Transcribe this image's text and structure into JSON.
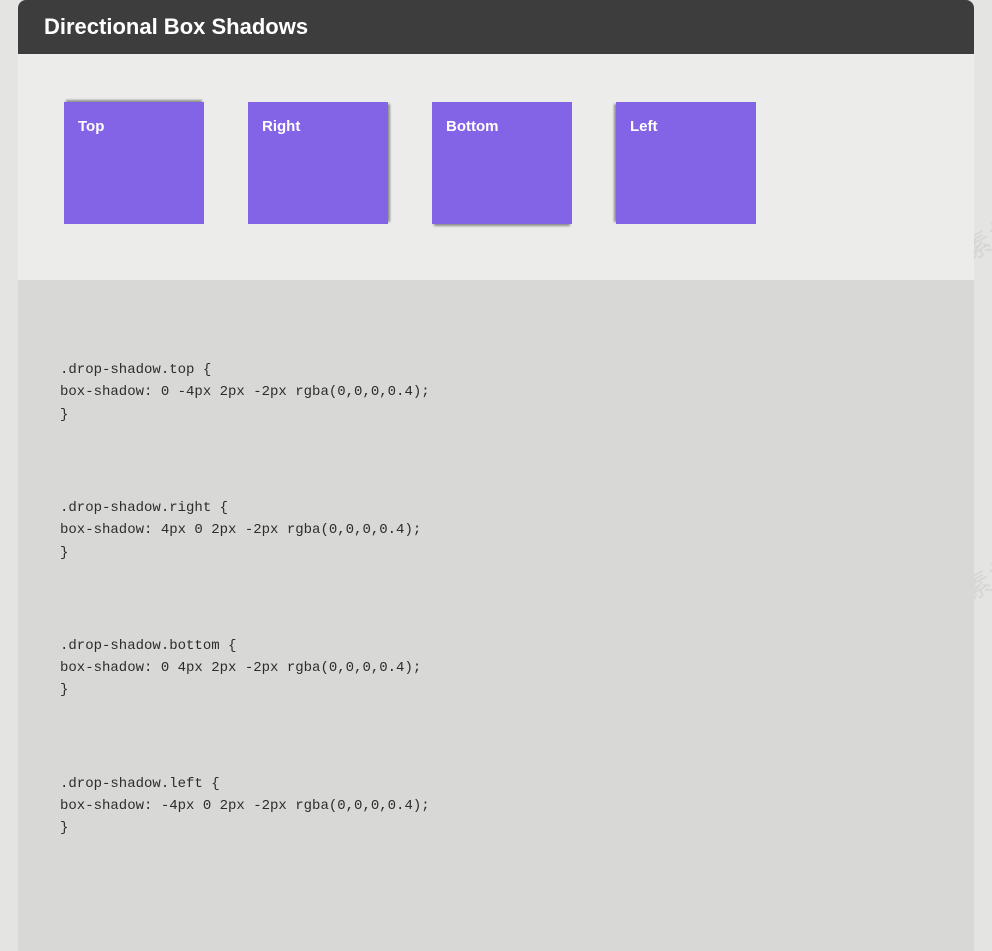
{
  "header": {
    "title": "Directional Box Shadows"
  },
  "boxes": [
    {
      "label": "Top",
      "class": "top"
    },
    {
      "label": "Right",
      "class": "right"
    },
    {
      "label": "Bottom",
      "class": "bottom"
    },
    {
      "label": "Left",
      "class": "left"
    }
  ],
  "code": {
    "top": ".drop-shadow.top {\nbox-shadow: 0 -4px 2px -2px rgba(0,0,0,0.4);\n}",
    "right": ".drop-shadow.right {\nbox-shadow: 4px 0 2px -2px rgba(0,0,0,0.4);\n}",
    "bottom": ".drop-shadow.bottom {\nbox-shadow: 0 4px 2px -2px rgba(0,0,0,0.4);\n}",
    "left": ".drop-shadow.left {\nbox-shadow: -4px 0 2px -2px rgba(0,0,0,0.4);\n}"
  },
  "watermark_text": "HTML素材网"
}
